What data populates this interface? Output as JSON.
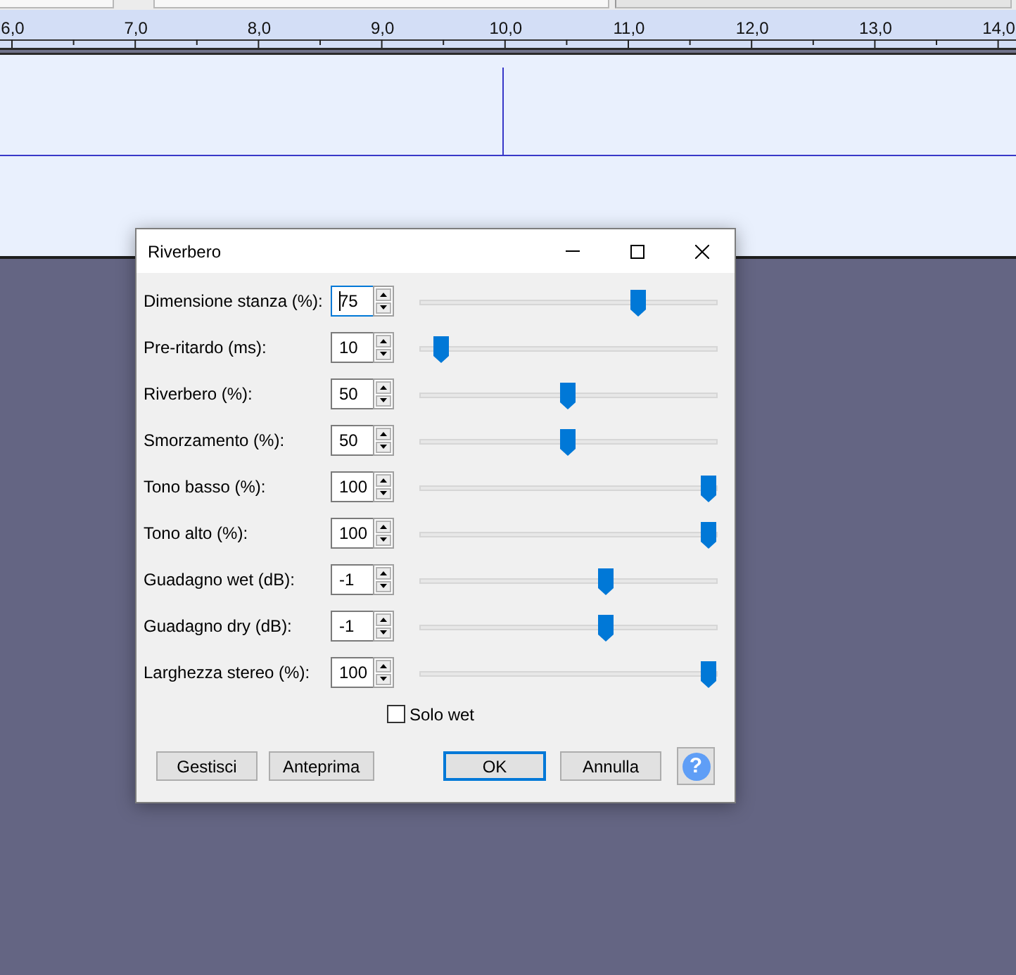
{
  "ruler": {
    "labels": [
      "6,0",
      "7,0",
      "8,0",
      "9,0",
      "10,0",
      "11,0",
      "12,0",
      "13,0",
      "14,0"
    ]
  },
  "dialog": {
    "title": "Riverbero",
    "params": [
      {
        "label": "Dimensione stanza (%):",
        "value": "75",
        "focused": true,
        "level": 0.75
      },
      {
        "label": "Pre-ritardo (ms):",
        "value": "10",
        "focused": false,
        "level": 0.05
      },
      {
        "label": "Riverbero (%):",
        "value": "50",
        "focused": false,
        "level": 0.5
      },
      {
        "label": "Smorzamento (%):",
        "value": "50",
        "focused": false,
        "level": 0.5
      },
      {
        "label": "Tono basso (%):",
        "value": "100",
        "focused": false,
        "level": 1
      },
      {
        "label": "Tono alto (%):",
        "value": "100",
        "focused": false,
        "level": 1
      },
      {
        "label": "Guadagno wet (dB):",
        "value": "-1",
        "focused": false,
        "level": 0.633
      },
      {
        "label": "Guadagno dry (dB):",
        "value": "-1",
        "focused": false,
        "level": 0.633
      },
      {
        "label": "Larghezza stereo (%):",
        "value": "100",
        "focused": false,
        "level": 1
      }
    ],
    "solo_wet": {
      "label": "Solo wet",
      "checked": false
    },
    "left_buttons": [
      {
        "label": "Gestisci",
        "default": false
      },
      {
        "label": "Anteprima",
        "default": false
      }
    ],
    "right_buttons": [
      {
        "label": "OK",
        "default": true
      },
      {
        "label": "Annulla",
        "default": false
      }
    ],
    "help_button": {
      "label": "?"
    }
  }
}
